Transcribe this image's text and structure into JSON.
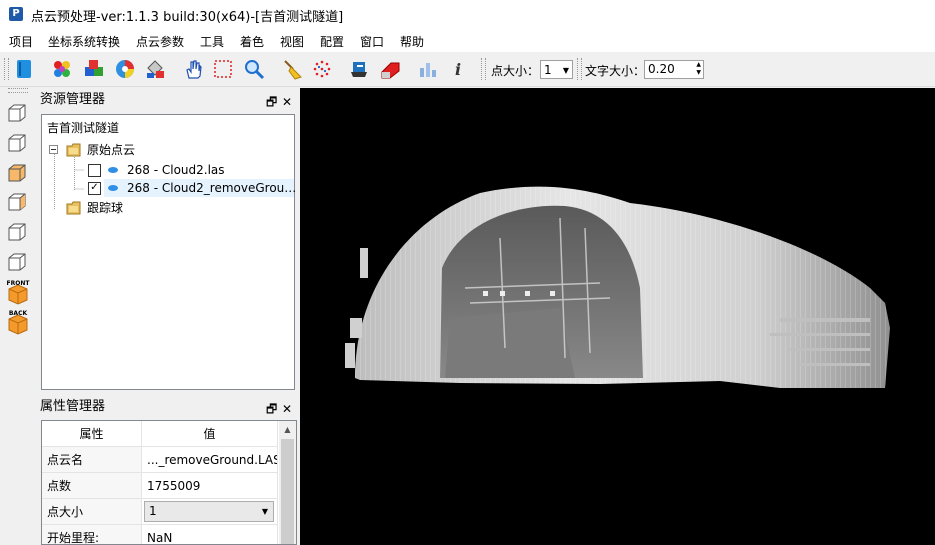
{
  "window": {
    "title": "点云预处理-ver:1.1.3 build:30(x64)-[吉首测试隧道]",
    "logo_letter": "P"
  },
  "menu": [
    "项目",
    "坐标系统转换",
    "点云参数",
    "工具",
    "着色",
    "视图",
    "配置",
    "窗口",
    "帮助"
  ],
  "toolbar": {
    "point_size_label": "点大小：",
    "point_size_value": "1",
    "text_size_label": "文字大小：",
    "text_size_value": "0.20"
  },
  "view_labels": {
    "front": "FRONT",
    "back": "BACK"
  },
  "resource_panel": {
    "title": "资源管理器",
    "root": "吉首测试隧道",
    "folder_raw": "原始点云",
    "cloud1": "268 - Cloud2.las",
    "cloud2": "268 - Cloud2_removeGrou…",
    "folder_track": "跟踪球",
    "cloud1_checked": false,
    "cloud2_checked": true
  },
  "property_panel": {
    "title": "属性管理器",
    "col_name": "属性",
    "col_value": "值",
    "rows": [
      {
        "name": "点云名",
        "value": "..._removeGround.LAS"
      },
      {
        "name": "点数",
        "value": "1755009"
      },
      {
        "name": "点大小",
        "value": "1"
      },
      {
        "name": "开始里程:",
        "value": "NaN"
      }
    ]
  },
  "panel_controls": {
    "float": "🗗",
    "close": "✕"
  },
  "colors": {
    "viewport_bg": "#000000",
    "selection": "#cce8ff",
    "cube": "#f39a2b"
  }
}
